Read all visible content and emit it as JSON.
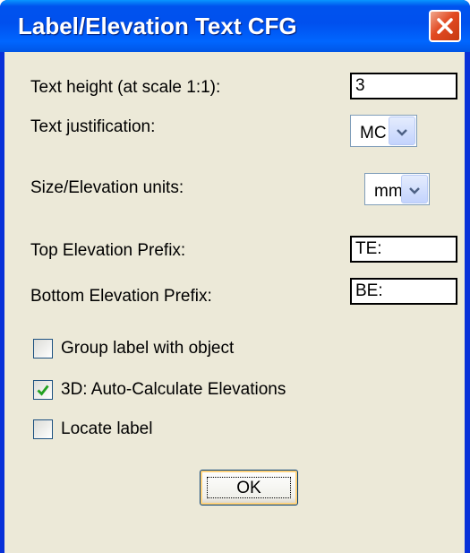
{
  "window": {
    "title": "Label/Elevation Text CFG",
    "close_icon": "close-x-icon",
    "title_bar_color": "#0054e3"
  },
  "form": {
    "text_height": {
      "label": "Text height (at scale 1:1):",
      "value": "3"
    },
    "text_justification": {
      "label": "Text justification:",
      "value": "MC"
    },
    "units": {
      "label": "Size/Elevation units:",
      "value": "mm"
    },
    "top_prefix": {
      "label": "Top Elevation Prefix:",
      "value": "TE:"
    },
    "bottom_prefix": {
      "label": "Bottom Elevation Prefix:",
      "value": "BE:"
    }
  },
  "options": [
    {
      "label": "Group label with object",
      "checked": false
    },
    {
      "label": "3D: Auto-Calculate Elevations",
      "checked": true
    },
    {
      "label": "Locate label",
      "checked": false
    }
  ],
  "ok_label": "OK"
}
